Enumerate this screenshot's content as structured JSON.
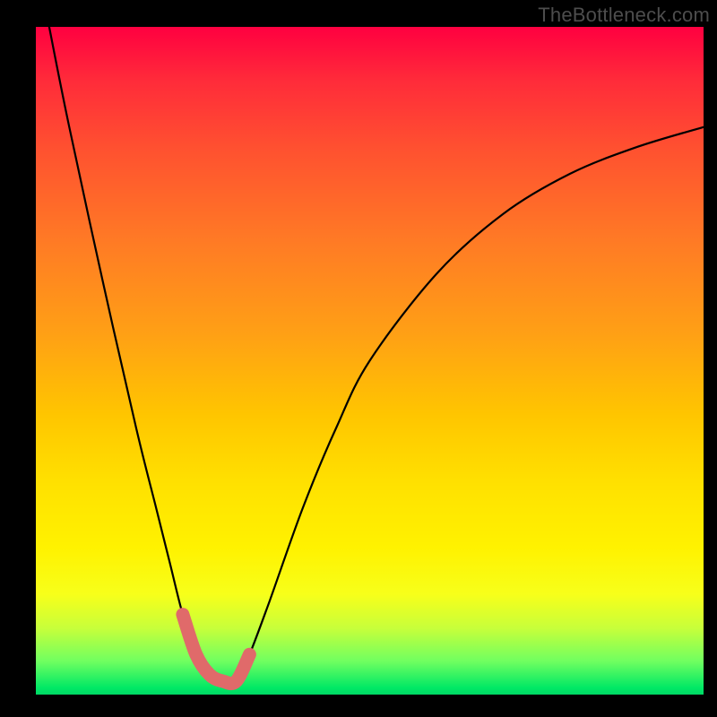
{
  "watermark": "TheBottleneck.com",
  "chart_data": {
    "type": "line",
    "title": "",
    "xlabel": "",
    "ylabel": "",
    "xlim": [
      0,
      100
    ],
    "ylim": [
      0,
      100
    ],
    "grid": false,
    "series": [
      {
        "name": "main-curve",
        "color": "#000000",
        "x": [
          2,
          5,
          10,
          15,
          18,
          20,
          22,
          24,
          26,
          28,
          30,
          32,
          35,
          40,
          45,
          50,
          60,
          70,
          80,
          90,
          100
        ],
        "y": [
          100,
          85,
          62,
          40,
          28,
          20,
          12,
          6,
          3,
          2,
          2,
          6,
          14,
          28,
          40,
          50,
          63,
          72,
          78,
          82,
          85
        ]
      },
      {
        "name": "valley-highlight",
        "color": "#e06a6a",
        "x": [
          22,
          24,
          26,
          28,
          30,
          32
        ],
        "y": [
          12,
          6,
          3,
          2,
          2,
          6
        ]
      }
    ]
  }
}
